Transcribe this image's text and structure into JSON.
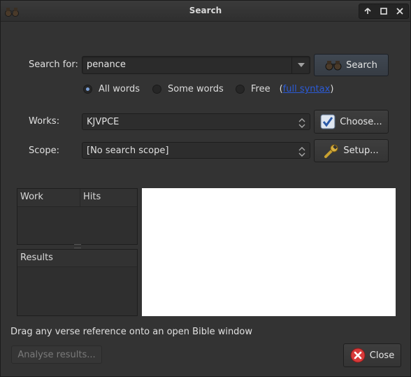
{
  "window": {
    "title": "Search",
    "app_icon": "binoculars-icon",
    "controls": [
      "up-arrow-icon",
      "maximize-icon",
      "close-icon"
    ]
  },
  "search": {
    "label": "Search for:",
    "value": "penance",
    "button_label": "Search",
    "button_icon": "binoculars-icon",
    "modes": [
      {
        "label": "All words",
        "selected": true
      },
      {
        "label": "Some words",
        "selected": false
      },
      {
        "label": "Free",
        "selected": false
      }
    ],
    "full_syntax_link": "full syntax",
    "paren_open": "(",
    "paren_close": ")"
  },
  "works": {
    "label": "Works:",
    "value": "KJVPCE",
    "button_label": "Choose...",
    "button_icon": "checkbox-icon"
  },
  "scope": {
    "label": "Scope:",
    "value": "[No search scope]",
    "button_label": "Setup...",
    "button_icon": "wrench-icon"
  },
  "results_table": {
    "columns": [
      "Work",
      "Hits"
    ],
    "results_header": "Results"
  },
  "status_text": "Drag any verse reference onto an open Bible window",
  "footer": {
    "analyse_label": "Analyse results...",
    "close_label": "Close",
    "close_icon": "close-circle-icon"
  },
  "colors": {
    "background": "#333333",
    "preview": "#ffffff",
    "link": "#2b5bd8",
    "close_icon": "#d83a3a"
  }
}
